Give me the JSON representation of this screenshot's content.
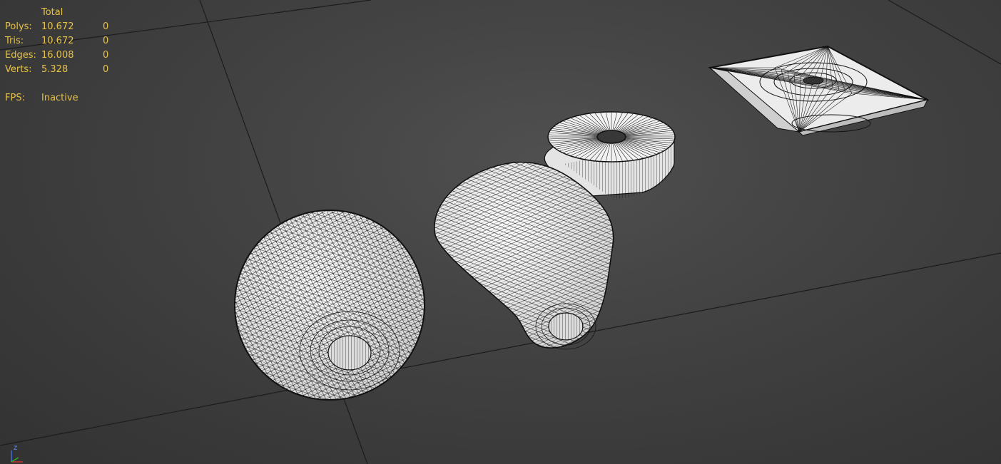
{
  "stats": {
    "header": "Total",
    "rows": [
      {
        "label": "Polys:",
        "total": "10.672",
        "selected": "0"
      },
      {
        "label": "Tris:",
        "total": "10.672",
        "selected": "0"
      },
      {
        "label": "Edges:",
        "total": "16.008",
        "selected": "0"
      },
      {
        "label": "Verts:",
        "total": "5.328",
        "selected": "0"
      }
    ],
    "fps_label": "FPS:",
    "fps_value": "Inactive"
  },
  "colors": {
    "stats_text": "#e6c24a",
    "mesh_fill": "#ececec",
    "wire": "#111111",
    "grid": "#1c1c1c"
  },
  "objects": [
    "sphere-knob",
    "stem-body",
    "star-plate"
  ],
  "gizmo": {
    "z_label": "z"
  }
}
